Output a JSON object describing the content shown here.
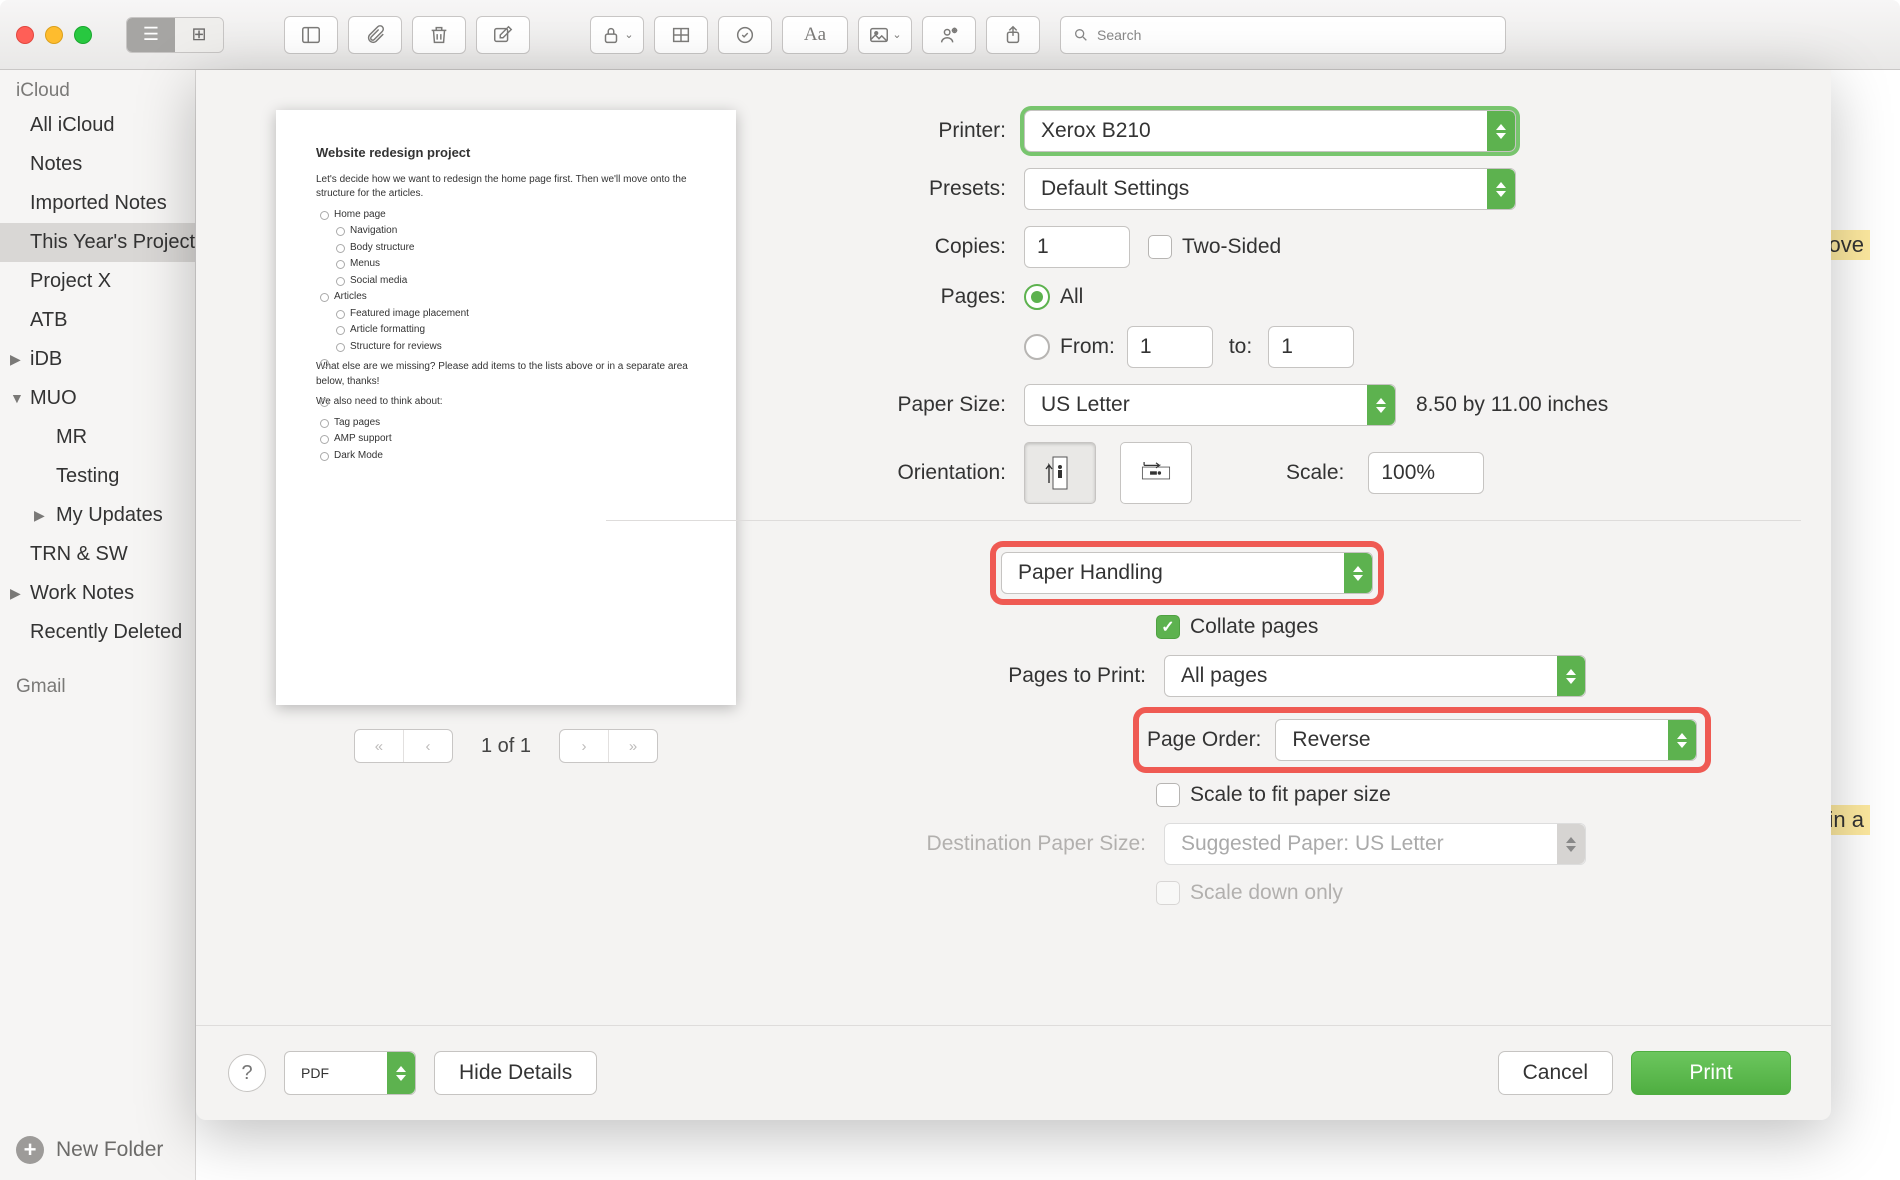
{
  "search_placeholder": "Search",
  "sidebar": {
    "sections": [
      {
        "header": "iCloud",
        "items": [
          {
            "label": "All iCloud"
          },
          {
            "label": "Notes"
          },
          {
            "label": "Imported Notes"
          },
          {
            "label": "This Year's Projects",
            "selected": true
          },
          {
            "label": "Project X"
          },
          {
            "label": "ATB"
          },
          {
            "label": "iDB",
            "arrow": "▶"
          },
          {
            "label": "MUO",
            "arrow": "▼"
          },
          {
            "label": "MR",
            "child": true
          },
          {
            "label": "Testing",
            "child": true
          },
          {
            "label": "My Updates",
            "child": true,
            "arrow": "▶"
          },
          {
            "label": "TRN & SW"
          },
          {
            "label": "Work Notes",
            "arrow": "▶"
          },
          {
            "label": "Recently Deleted"
          }
        ]
      },
      {
        "header": "Gmail",
        "items": []
      }
    ],
    "new_folder": "New Folder"
  },
  "preview": {
    "title": "Website redesign project",
    "intro": "Let's decide how we want to redesign the home page first. Then we'll move onto the structure for the articles.",
    "list": [
      "Home page",
      "Navigation",
      "Body structure",
      "Menus",
      "Social media",
      "Articles",
      "Featured image placement",
      "Article formatting",
      "Structure for reviews"
    ],
    "q": "What else are we missing? Please add items to the lists above or in a separate area below, thanks!",
    "also": "We also need to think about:",
    "list2": [
      "Tag pages",
      "AMP support",
      "Dark Mode"
    ],
    "page_indicator": "1 of 1"
  },
  "print": {
    "labels": {
      "printer": "Printer:",
      "presets": "Presets:",
      "copies": "Copies:",
      "two_sided": "Two-Sided",
      "pages": "Pages:",
      "all": "All",
      "from": "From:",
      "to": "to:",
      "paper_size": "Paper Size:",
      "paper_hint": "8.50 by 11.00 inches",
      "orientation": "Orientation:",
      "scale": "Scale:",
      "collate": "Collate pages",
      "pages_to_print": "Pages to Print:",
      "page_order": "Page Order:",
      "scale_fit": "Scale to fit paper size",
      "dest_paper": "Destination Paper Size:",
      "scale_down": "Scale down only"
    },
    "values": {
      "printer": "Xerox B210",
      "preset": "Default Settings",
      "copies": "1",
      "from": "1",
      "to": "1",
      "paper_size": "US Letter",
      "scale": "100%",
      "section": "Paper Handling",
      "pages_to_print": "All pages",
      "page_order": "Reverse",
      "dest_paper": "Suggested Paper: US Letter"
    }
  },
  "footer": {
    "pdf": "PDF",
    "hide": "Hide Details",
    "cancel": "Cancel",
    "print": "Print"
  },
  "background": {
    "hl1": "we'll move",
    "hl2": "in a"
  }
}
